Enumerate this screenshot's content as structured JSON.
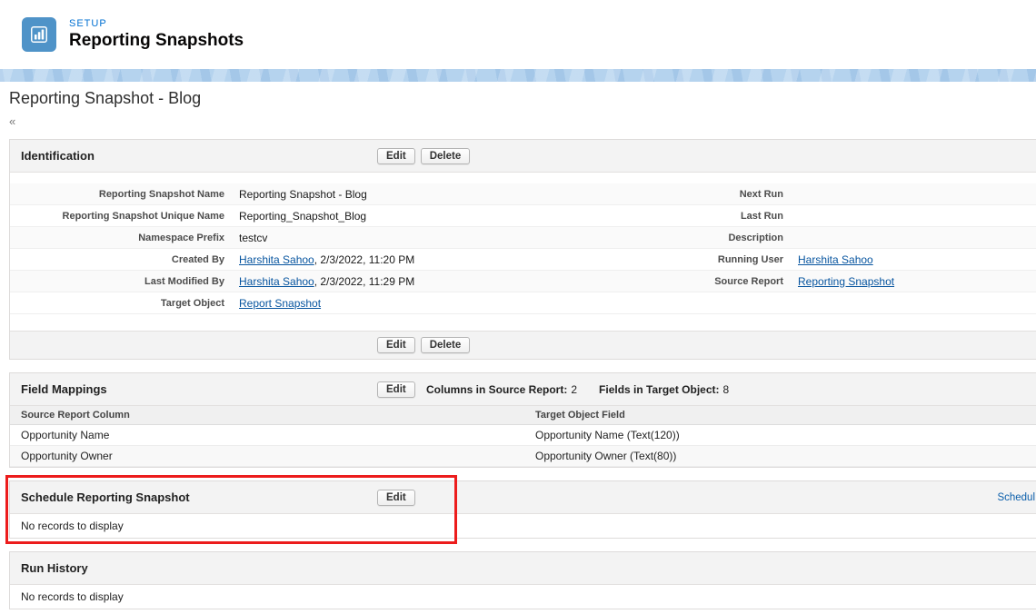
{
  "colors": {
    "setup_label_blue": "#0070d2",
    "icon_background": "#4f93c8",
    "banner_blue": "#b5d3ee",
    "link_blue": "#06549f",
    "annotation_red": "#ec1c1c"
  },
  "header": {
    "eyebrow": "SETUP",
    "title": "Reporting Snapshots",
    "icon": "bar-chart-icon"
  },
  "page": {
    "title": "Reporting Snapshot - Blog",
    "collapse_glyph": "«"
  },
  "identification": {
    "title": "Identification",
    "edit_label": "Edit",
    "delete_label": "Delete",
    "rows": [
      {
        "l_label": "Reporting Snapshot Name",
        "l_value": "Reporting Snapshot - Blog",
        "r_label": "Next Run",
        "r_value": ""
      },
      {
        "l_label": "Reporting Snapshot Unique Name",
        "l_value": "Reporting_Snapshot_Blog",
        "r_label": "Last Run",
        "r_value": ""
      },
      {
        "l_label": "Namespace Prefix",
        "l_value": "testcv",
        "r_label": "Description",
        "r_value": ""
      },
      {
        "l_label": "Created By",
        "l_link": "Harshita Sahoo",
        "l_suffix": ", 2/3/2022, 11:20 PM",
        "r_label": "Running User",
        "r_link": "Harshita Sahoo"
      },
      {
        "l_label": "Last Modified By",
        "l_link": "Harshita Sahoo",
        "l_suffix": ", 2/3/2022, 11:29 PM",
        "r_label": "Source Report",
        "r_link": "Reporting Snapshot"
      },
      {
        "l_label": "Target Object",
        "l_link": "Report Snapshot",
        "l_suffix": "",
        "r_label": "",
        "r_value": ""
      }
    ]
  },
  "field_mappings": {
    "title": "Field Mappings",
    "edit_label": "Edit",
    "stat1_label": "Columns in Source Report:",
    "stat1_value": "2",
    "stat2_label": "Fields in Target Object:",
    "stat2_value": "8",
    "col1": "Source Report Column",
    "col2": "Target Object Field",
    "rows": [
      {
        "source": "Opportunity Name",
        "target": "Opportunity Name (Text(120))"
      },
      {
        "source": "Opportunity Owner",
        "target": "Opportunity Owner (Text(80))"
      }
    ]
  },
  "schedule": {
    "title": "Schedule Reporting Snapshot",
    "edit_label": "Edit",
    "help_link": "Schedul",
    "empty": "No records to display"
  },
  "run_history": {
    "title": "Run History",
    "empty": "No records to display"
  }
}
